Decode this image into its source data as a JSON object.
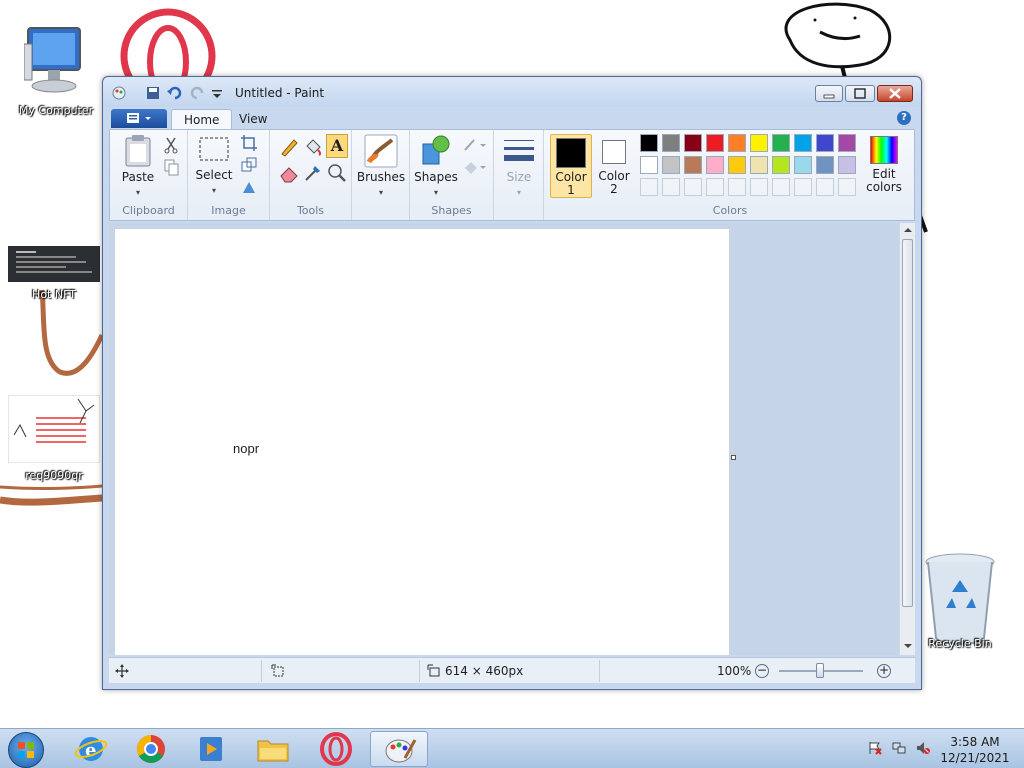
{
  "desktop": {
    "icons": [
      {
        "label": "My Computer"
      },
      {
        "label": "Hot NFT"
      },
      {
        "label": "req9090qr"
      },
      {
        "label": "Recycle Bin"
      }
    ]
  },
  "window": {
    "title": "Untitled - Paint",
    "tabs": [
      {
        "label": "Home"
      },
      {
        "label": "View"
      }
    ],
    "help_symbol": "?"
  },
  "ribbon": {
    "clipboard": {
      "label": "Clipboard",
      "paste": "Paste"
    },
    "image": {
      "label": "Image",
      "select": "Select"
    },
    "tools": {
      "label": "Tools",
      "text_tool": "A"
    },
    "brushes": {
      "label": "Brushes"
    },
    "shapes": {
      "label": "Shapes",
      "group_label": "Shapes"
    },
    "size": {
      "label": "Size"
    },
    "colors": {
      "label": "Colors",
      "color1": "Color\n1",
      "color1_line1": "Color",
      "color1_line2": "1",
      "color2_line1": "Color",
      "color2_line2": "2",
      "edit_line1": "Edit",
      "edit_line2": "colors",
      "color1_value": "#000000",
      "color2_value": "#ffffff",
      "palette_row1": [
        "#000000",
        "#7f7f7f",
        "#880015",
        "#ed1c24",
        "#ff7f27",
        "#fff200",
        "#22b14c",
        "#00a2e8",
        "#3f48cc",
        "#a349a4"
      ],
      "palette_row2": [
        "#ffffff",
        "#c3c3c3",
        "#b97a57",
        "#ffaec9",
        "#ffc90e",
        "#efe4b0",
        "#b5e61d",
        "#99d9ea",
        "#7092be",
        "#c8bfe7"
      ]
    }
  },
  "canvas": {
    "text": "nopr",
    "background": "#ffffff"
  },
  "status": {
    "dimensions": "614 × 460px",
    "zoom": "100%",
    "zoom_minus": "−",
    "zoom_plus": "+"
  },
  "taskbar": {
    "apps": [
      "start-button",
      "internet-explorer",
      "chrome",
      "media-player",
      "file-explorer",
      "opera",
      "paint"
    ],
    "time": "3:58 AM",
    "date": "12/21/2021"
  }
}
